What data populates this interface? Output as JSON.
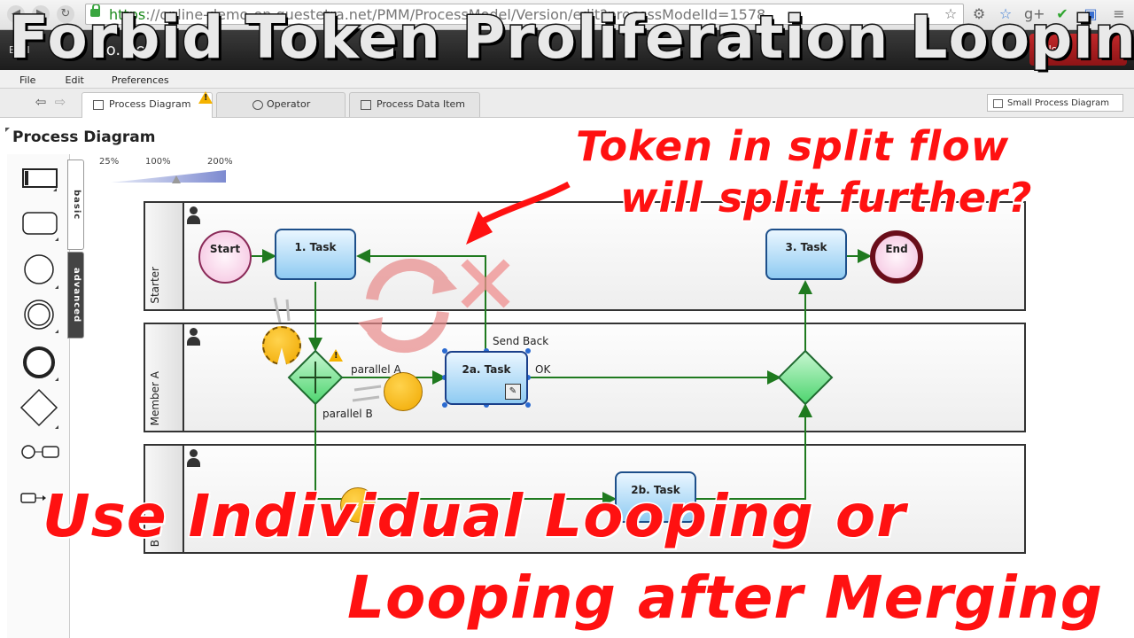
{
  "browser": {
    "url_scheme": "https",
    "url_rest": "://online-demo-en.questetra.net/PMM/ProcessModel/Version/edit?processModelId=1578",
    "icons": [
      "star-icon",
      "extension-icon",
      "menu-icon"
    ]
  },
  "app": {
    "brand": "BPM",
    "title": "Lo... e",
    "close_label": "Close"
  },
  "menu": {
    "items": [
      "File",
      "Edit",
      "Preferences"
    ]
  },
  "tabs": {
    "items": [
      {
        "label": "Process Diagram",
        "active": true,
        "warning": true
      },
      {
        "label": "Operator",
        "active": false
      },
      {
        "label": "Process Data Item",
        "active": false
      }
    ],
    "small_diagram_label": "Small Process Diagram"
  },
  "panel": {
    "title": "Process Diagram",
    "palette_tabs": [
      "basic",
      "advanced"
    ],
    "zoom_labels": [
      "25%",
      "100%",
      "200%"
    ],
    "zoom_level": "100%"
  },
  "diagram": {
    "lanes": [
      "Starter",
      "Member A",
      "B"
    ],
    "nodes": {
      "start": "Start",
      "task1": "1. Task",
      "task2a": "2a. Task",
      "task2b": "2b. Task",
      "task3": "3. Task",
      "end": "End"
    },
    "edge_labels": {
      "parallel_a": "parallel A",
      "parallel_b": "parallel B",
      "send_back": "Send Back",
      "ok": "OK"
    }
  },
  "captions": {
    "title": "Forbid Token Proliferation Looping",
    "question_line1": "Token in split flow",
    "question_line2": "will split further?",
    "answer_line1": "Use Individual Looping or",
    "answer_line2": "Looping after Merging"
  },
  "colors": {
    "caption_red": "#ff1111",
    "task_fill": "#8fcbf2",
    "gateway_fill": "#6fe08a",
    "token": "#f0a800",
    "flow": "#1f7a1f"
  }
}
